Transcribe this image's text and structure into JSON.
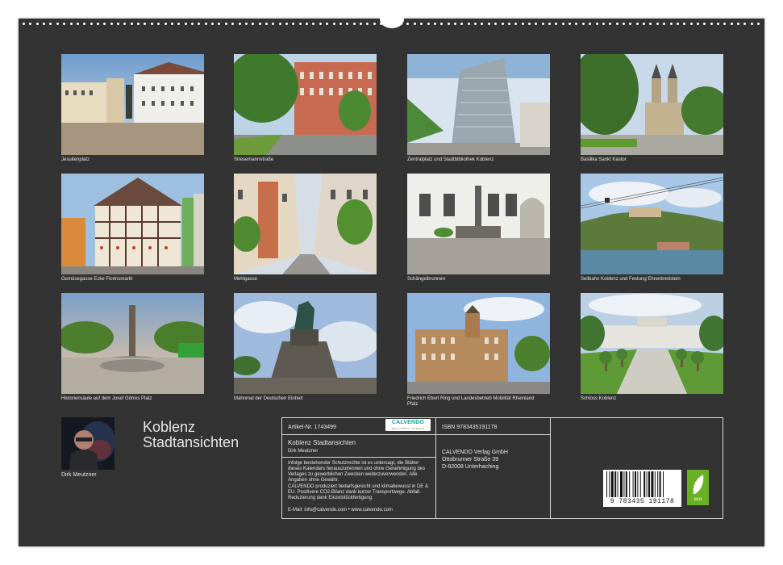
{
  "tiles": [
    {
      "caption": "Jesuitenplatz"
    },
    {
      "caption": "Stresemannstraße"
    },
    {
      "caption": "Zentralplatz und Stadtbibliothek Koblenz"
    },
    {
      "caption": "Basilika Sankt Kastor"
    },
    {
      "caption": "Gemüsegasse Ecke Florinsmarkt"
    },
    {
      "caption": "Mehlgasse"
    },
    {
      "caption": "Schängelbrunnen"
    },
    {
      "caption": "Seilbahn Koblenz und Festung Ehrenbreitstein"
    },
    {
      "caption": "Historiensäule auf dem Josef Görres Platz"
    },
    {
      "caption": "Mahnmal der Deutschen Einheit"
    },
    {
      "caption": "Friedrich Ebert Ring und Landesbetrieb Mobilität Rheinland",
      "caption2": "Pfalz"
    },
    {
      "caption": "Schloss Koblenz"
    }
  ],
  "author": {
    "name": "Dirk Meutzner"
  },
  "title": {
    "line1": "Koblenz",
    "line2": "Stadtansichten"
  },
  "info": {
    "article": "Artikel-Nr. 1743499",
    "product_title": "Koblenz Stadtansichten",
    "author": "Dirk Meutzner",
    "legal": "Infolge bestehender Schutzrechte ist es untersagt, die Blätter dieses Kalenders herauszutrennen und ohne Genehmigung des Verlages zu gewerblichen Zwecken weiterzuverwenden. Alle Angaben ohne Gewähr.",
    "eco_note": "CALVENDO produziert bedarfsgerecht und klimabewusst in DE & EU. Positivere CO2-Bilanz dank kurzer Transportwege. Abfall-Reduzierung dank Einzelstückfertigung.",
    "contact": "E-Mail: info@calvendo.com • www.calvendo.com",
    "isbn": "ISBN 9783435191178",
    "publisher_name": "CALVENDO Verlag GmbH",
    "publisher_street": "Ottobrunner Straße 39",
    "publisher_city": "D-82008 Unterhaching",
    "barcode_number": "9 783435 191178"
  },
  "badge": {
    "brand": "CALVENDO",
    "tag": "BEST IN PRINT · CALENDAR"
  },
  "eco_label": "eco",
  "colors": {
    "background": "#333333",
    "accent": "#1ea39a",
    "eco": "#6ab023"
  }
}
